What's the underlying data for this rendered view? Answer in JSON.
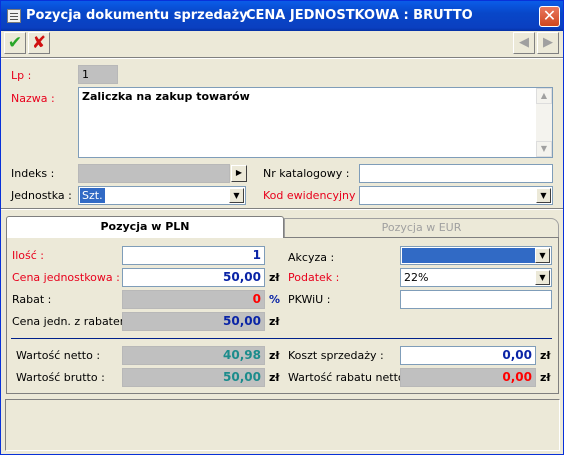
{
  "window": {
    "title": "Pozycja dokumentu sprzedaży",
    "mode": "CENA JEDNOSTKOWA : BRUTTO",
    "close_glyph": "✕"
  },
  "toolbar": {
    "ok_glyph": "✔",
    "cancel_glyph": "✘",
    "prev_glyph": "◀",
    "next_glyph": "▶"
  },
  "form": {
    "lp_label": "Lp :",
    "lp_value": "1",
    "nazwa_label": "Nazwa :",
    "nazwa_value": "Zaliczka na zakup towarów",
    "indeks_label": "Indeks :",
    "indeks_value": "",
    "nr_katalogowy_label": "Nr katalogowy :",
    "nr_katalogowy_value": "",
    "jednostka_label": "Jednostka :",
    "jednostka_value": "Szt.",
    "kod_ewidencyjny_label": "Kod ewidencyjny :",
    "kod_ewidencyjny_value": ""
  },
  "tabs": [
    {
      "label": "Pozycja w PLN",
      "active": true
    },
    {
      "label": "Pozycja w EUR",
      "active": false
    }
  ],
  "pln": {
    "ilosc_label": "Ilość :",
    "ilosc_value": "1",
    "cena_label": "Cena jednostkowa :",
    "cena_value": "50,00",
    "rabat_label": "Rabat :",
    "rabat_value": "0",
    "cena_rabat_label": "Cena jedn. z rabatem :",
    "cena_rabat_value": "50,00",
    "akcyza_label": "Akcyza :",
    "akcyza_value": "",
    "podatek_label": "Podatek :",
    "podatek_value": "22%",
    "pkwiu_label": "PKWiU :",
    "pkwiu_value": "",
    "netto_label": "Wartość netto :",
    "netto_value": "40,98",
    "brutto_label": "Wartość brutto :",
    "brutto_value": "50,00",
    "koszt_label": "Koszt sprzedaży :",
    "koszt_value": "0,00",
    "rabat_netto_label": "Wartość rabatu netto :",
    "rabat_netto_value": "0,00",
    "currency": "zł",
    "percent": "%"
  },
  "colors": {
    "title_bar": "#0a3fc0",
    "required_label": "#e8001c",
    "value_blue": "#0a24a6",
    "value_green": "#1c8c8c",
    "value_red": "#ff0000"
  }
}
